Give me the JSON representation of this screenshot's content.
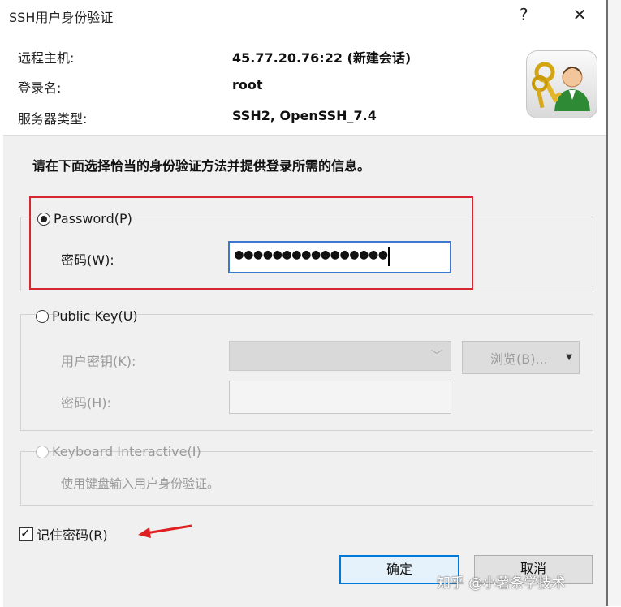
{
  "window": {
    "title": "SSH用户身份验证",
    "help_glyph": "?",
    "close_glyph": "✕"
  },
  "info": {
    "host_label": "远程主机:",
    "host_value": "45.77.20.76:22 (新建会话)",
    "login_label": "登录名:",
    "login_value": "root",
    "server_type_label": "服务器类型:",
    "server_type_value": "SSH2, OpenSSH_7.4",
    "icon": "keys-user-icon"
  },
  "instruction": "请在下面选择恰当的身份验证方法并提供登录所需的信息。",
  "password_method": {
    "label": "Password(P)",
    "selected": true,
    "password_label": "密码(W):",
    "password_value": "●●●●●●●●●●●●●●●●"
  },
  "public_key_method": {
    "label": "Public Key(U)",
    "selected": false,
    "user_key_label": "用户密钥(K):",
    "user_key_value": "",
    "browse_label": "浏览(B)...",
    "passphrase_label": "密码(H):",
    "passphrase_value": ""
  },
  "keyboard_method": {
    "label": "Keyboard Interactive(I)",
    "selected": false,
    "description": "使用键盘输入用户身份验证。"
  },
  "remember_password": {
    "label": "记住密码(R)",
    "checked": true,
    "mark_glyph": "✓"
  },
  "buttons": {
    "ok": "确定",
    "cancel": "取消"
  },
  "watermark": "知乎 @小薯条学技术",
  "colors": {
    "highlight_box": "#d6262f",
    "annotation_arrow": "#e02020",
    "focus_border": "#3b79d0",
    "ok_border": "#0078d7"
  }
}
